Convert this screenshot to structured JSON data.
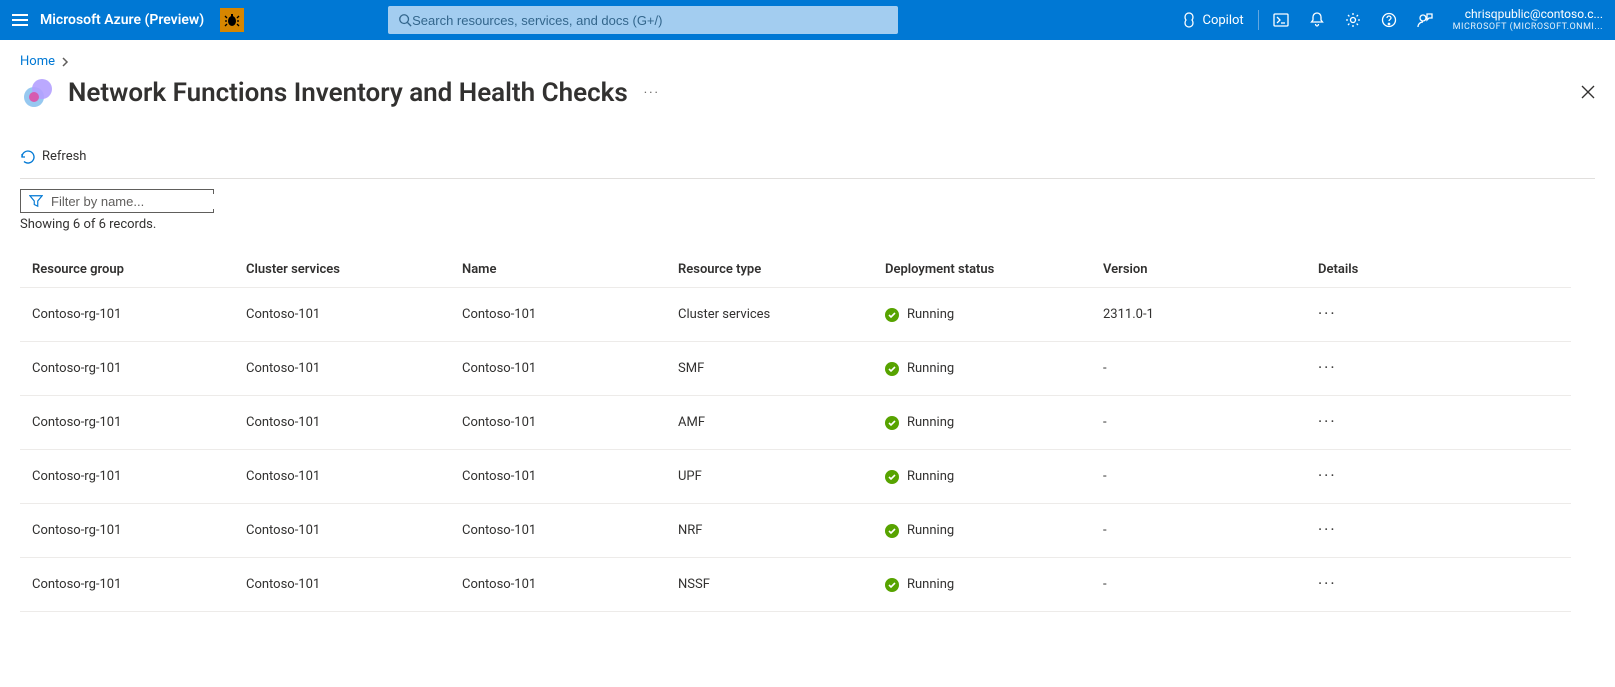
{
  "header": {
    "brand": "Microsoft Azure (Preview)",
    "search_placeholder": "Search resources, services, and docs (G+/)",
    "copilot_label": "Copilot",
    "account_email": "chrisqpublic@contoso.c...",
    "account_tenant": "MICROSOFT (MICROSOFT.ONMI..."
  },
  "breadcrumb": {
    "home": "Home"
  },
  "page": {
    "title": "Network Functions Inventory and Health Checks"
  },
  "toolbar": {
    "refresh": "Refresh"
  },
  "filter": {
    "placeholder": "Filter by name...",
    "record_count": "Showing 6 of 6 records."
  },
  "columns": {
    "resource_group": "Resource group",
    "cluster_services": "Cluster services",
    "name": "Name",
    "resource_type": "Resource type",
    "deployment_status": "Deployment status",
    "version": "Version",
    "details": "Details"
  },
  "rows": [
    {
      "rg": "Contoso-rg-101",
      "cluster": "Contoso-101",
      "name": "Contoso-101",
      "rtype": "Cluster services",
      "status": "Running",
      "version": "2311.0-1"
    },
    {
      "rg": "Contoso-rg-101",
      "cluster": "Contoso-101",
      "name": "Contoso-101",
      "rtype": "SMF",
      "status": "Running",
      "version": "-"
    },
    {
      "rg": "Contoso-rg-101",
      "cluster": "Contoso-101",
      "name": "Contoso-101",
      "rtype": "AMF",
      "status": "Running",
      "version": "-"
    },
    {
      "rg": "Contoso-rg-101",
      "cluster": "Contoso-101",
      "name": "Contoso-101",
      "rtype": "UPF",
      "status": "Running",
      "version": "-"
    },
    {
      "rg": "Contoso-rg-101",
      "cluster": "Contoso-101",
      "name": "Contoso-101",
      "rtype": "NRF",
      "status": "Running",
      "version": "-"
    },
    {
      "rg": "Contoso-rg-101",
      "cluster": "Contoso-101",
      "name": "Contoso-101",
      "rtype": "NSSF",
      "status": "Running",
      "version": "-"
    }
  ]
}
